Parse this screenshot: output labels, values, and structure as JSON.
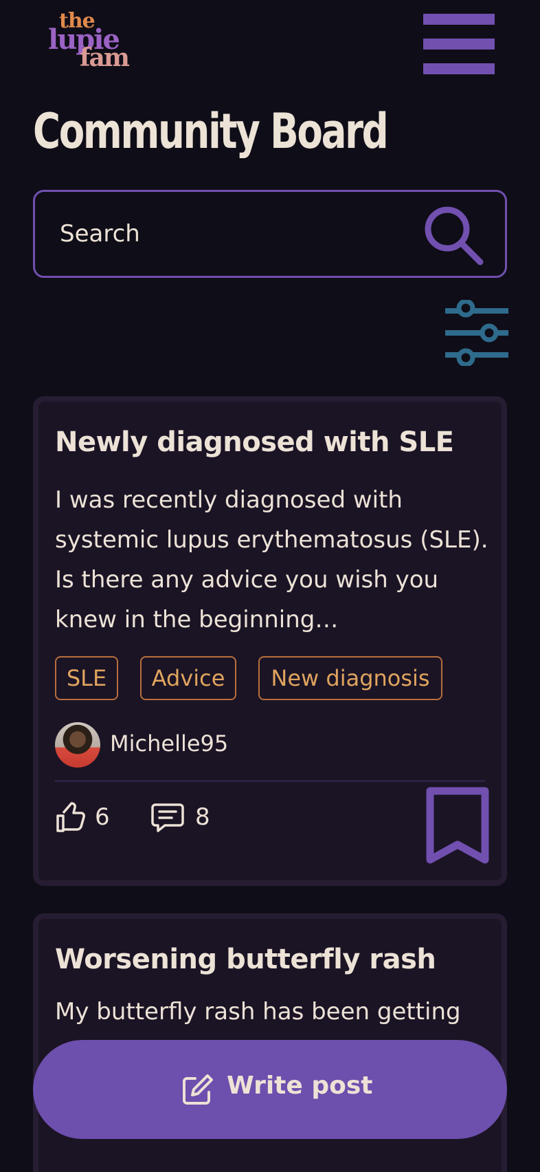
{
  "header": {
    "logo": {
      "line1": "the",
      "line2": "lupie",
      "line3": "fam"
    },
    "title": "Community Board"
  },
  "search": {
    "placeholder": "Search"
  },
  "posts": [
    {
      "title": "Newly diagnosed with SLE",
      "excerpt": "I was recently diagnosed with systemic lupus erythematosus (SLE). Is there any advice you wish you knew in the beginning…",
      "tags": [
        "SLE",
        "Advice",
        "New diagnosis"
      ],
      "author": "Michelle95",
      "likes": "6",
      "comments": "8"
    },
    {
      "title": "Worsening butterfly rash",
      "excerpt": "My butterfly rash has been getting"
    }
  ],
  "actions": {
    "write_post_label": "Write post"
  },
  "colors": {
    "background": "#0f0d17",
    "card": "#1b1425",
    "accent_purple": "#7150b0",
    "tag_orange": "#b86f3c",
    "filter_teal": "#2e6b8c",
    "text": "#ece2d6"
  }
}
